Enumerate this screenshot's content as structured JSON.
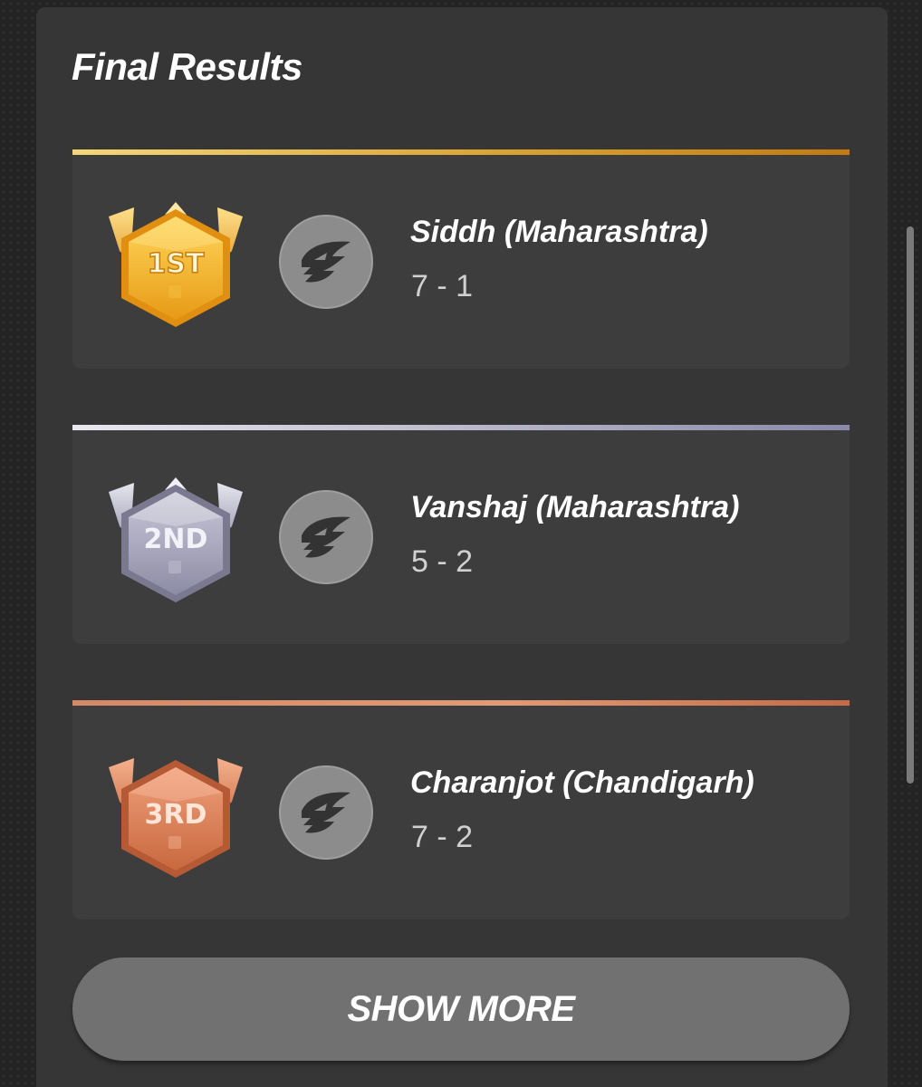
{
  "title": "Final Results",
  "results": [
    {
      "rank_label": "1ST",
      "medal_icon": "gold-medal-icon",
      "team_icon": "team-logo-icon",
      "name": "Siddh (Maharashtra)",
      "score": "7 - 1",
      "accent_color": "#d9a433"
    },
    {
      "rank_label": "2ND",
      "medal_icon": "silver-medal-icon",
      "team_icon": "team-logo-icon",
      "name": "Vanshaj (Maharashtra)",
      "score": "5 - 2",
      "accent_color": "#b6b5c8"
    },
    {
      "rank_label": "3RD",
      "medal_icon": "bronze-medal-icon",
      "team_icon": "team-logo-icon",
      "name": "Charanjot (Chandigarh)",
      "score": "7 - 2",
      "accent_color": "#e29a74"
    }
  ],
  "show_more_label": "SHOW MORE"
}
